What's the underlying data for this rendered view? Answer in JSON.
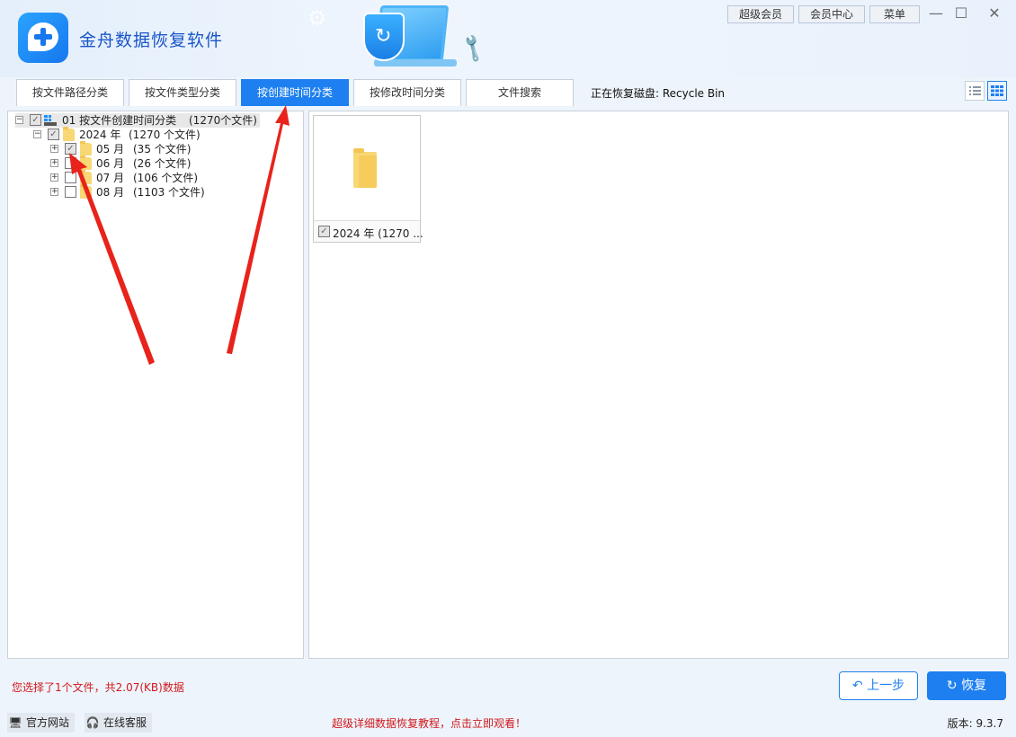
{
  "app": {
    "title": "金舟数据恢复软件"
  },
  "top_buttons": {
    "super_vip": "超级会员",
    "member_center": "会员中心",
    "menu": "菜单"
  },
  "window_controls": {
    "minimize": "—",
    "maximize": "☐",
    "close": "✕"
  },
  "tabs": [
    {
      "label": "按文件路径分类",
      "active": false
    },
    {
      "label": "按文件类型分类",
      "active": false
    },
    {
      "label": "按创建时间分类",
      "active": true
    },
    {
      "label": "按修改时间分类",
      "active": false
    },
    {
      "label": "文件搜索",
      "active": false
    }
  ],
  "recovering_disk": "正在恢复磁盘: Recycle Bin",
  "tree": {
    "root": {
      "label": "01  按文件创建时间分类",
      "count": "(1270个文件)",
      "checked": true
    },
    "year": {
      "label": "2024 年",
      "count": "(1270 个文件)",
      "checked": true
    },
    "months": [
      {
        "label": "05 月",
        "count": "(35 个文件)",
        "checked": true
      },
      {
        "label": "06 月",
        "count": "(26 个文件)",
        "checked": false
      },
      {
        "label": "07 月",
        "count": "(106 个文件)",
        "checked": false
      },
      {
        "label": "08 月",
        "count": "(1103 个文件)",
        "checked": false
      }
    ]
  },
  "grid": {
    "card_caption": "2024 年  (1270 ..."
  },
  "status_text": "您选择了1个文件，共2.07(KB)数据",
  "buttons": {
    "back": "上一步",
    "recover": "恢复"
  },
  "footer": {
    "website": "官方网站",
    "support": "在线客服",
    "promo": "超级详细数据恢复教程，点击立即观看！",
    "version": "版本: 9.3.7"
  },
  "colors": {
    "accent": "#1e80f0",
    "alert": "#d0191d",
    "arrow": "#e8231b"
  }
}
